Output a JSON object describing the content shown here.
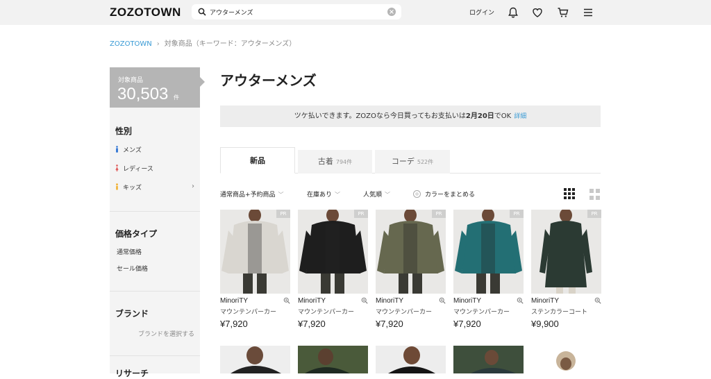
{
  "header": {
    "logo": "ZOZOTOWN",
    "search_value": "アウターメンズ",
    "login_label": "ログイン",
    "icons": [
      "search-icon",
      "clear-icon",
      "bell-icon",
      "heart-icon",
      "cart-icon",
      "menu-icon"
    ]
  },
  "breadcrumb": {
    "home": "ZOZOTOWN",
    "current": "対象商品（キーワード：アウターメンズ）"
  },
  "sidebar": {
    "count_label": "対象商品",
    "count_value": "30,503",
    "count_unit": "件",
    "gender_title": "性別",
    "gender_items": [
      {
        "label": "メンズ",
        "color": "#3a7bd5"
      },
      {
        "label": "レディース",
        "color": "#e05a5a"
      },
      {
        "label": "キッズ",
        "color": "#f0b030"
      }
    ],
    "price_type_title": "価格タイプ",
    "price_items": [
      "通常価格",
      "セール価格"
    ],
    "brand_title": "ブランド",
    "brand_select": "ブランドを選択する",
    "next_title": "リサーチ"
  },
  "main": {
    "title": "アウターメンズ",
    "notice_prefix": "ツケ払いできます。ZOZOなら今日買ってもお支払いは",
    "notice_date": "2月20日",
    "notice_suffix": "でOK",
    "notice_link": "詳細",
    "tabs": [
      {
        "label": "新品",
        "count": ""
      },
      {
        "label": "古着",
        "count": "794件"
      },
      {
        "label": "コーデ",
        "count": "522件"
      }
    ],
    "filters": {
      "type": "通常商品+予約商品",
      "stock": "在庫あり",
      "sort": "人気順",
      "color_group": "カラーをまとめる"
    }
  },
  "products": [
    {
      "brand": "MinoriTY",
      "category": "マウンテンパーカー",
      "price": "¥7,920",
      "badge": "PR",
      "color": "#d9d6d0"
    },
    {
      "brand": "MinoriTY",
      "category": "マウンテンパーカー",
      "price": "¥7,920",
      "badge": "PR",
      "color": "#1e1e1e"
    },
    {
      "brand": "MinoriTY",
      "category": "マウンテンパーカー",
      "price": "¥7,920",
      "badge": "PR",
      "color": "#66684f"
    },
    {
      "brand": "MinoriTY",
      "category": "マウンテンパーカー",
      "price": "¥7,920",
      "badge": "PR",
      "color": "#236f74"
    },
    {
      "brand": "MinoriTY",
      "category": "ステンカラーコート",
      "price": "¥9,900",
      "badge": "PR",
      "color": "#2b3a33"
    }
  ]
}
